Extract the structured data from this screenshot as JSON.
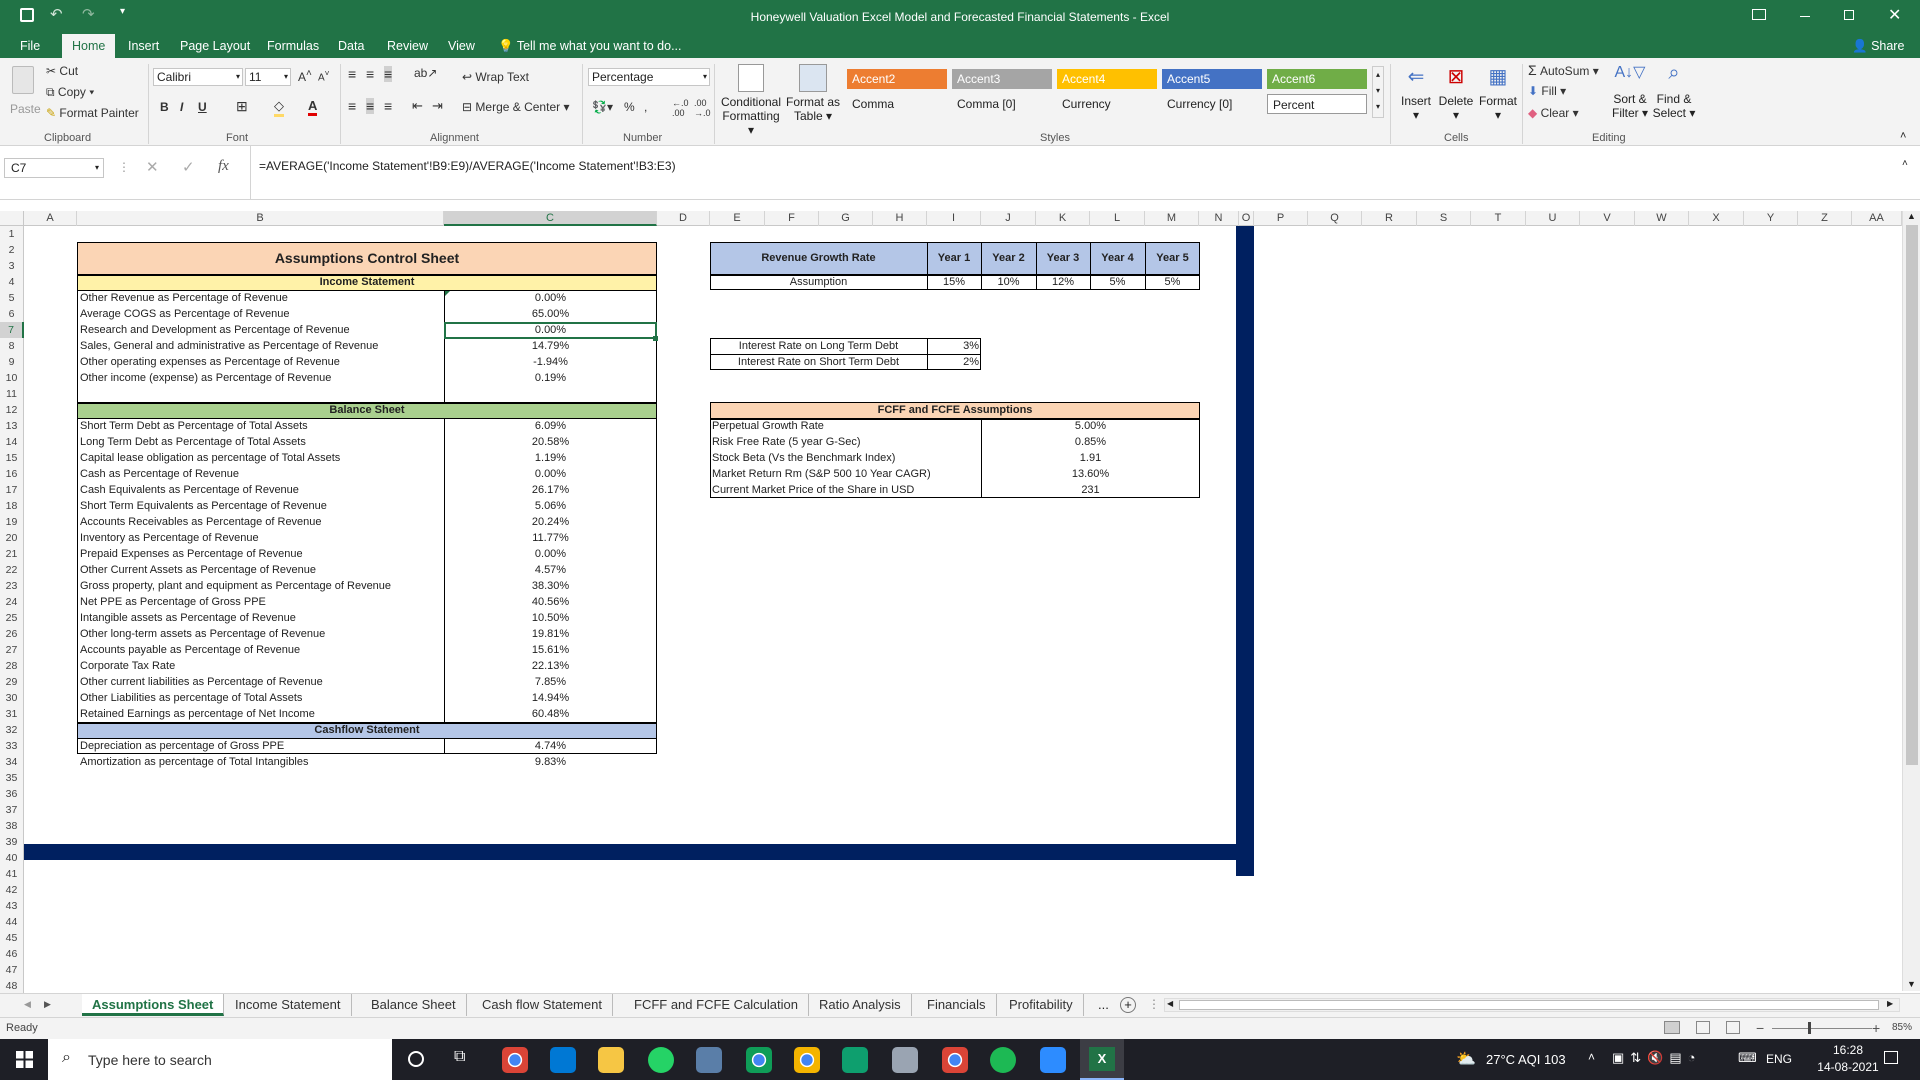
{
  "titlebar": {
    "title": "Honeywell Valuation Excel Model and Forecasted Financial Statements - Excel"
  },
  "ribbon_tabs": [
    "File",
    "Home",
    "Insert",
    "Page Layout",
    "Formulas",
    "Data",
    "Review",
    "View"
  ],
  "tell_me": "Tell me what you want to do...",
  "share": "Share",
  "clipboard": {
    "paste": "Paste",
    "cut": "Cut",
    "copy": "Copy",
    "painter": "Format Painter",
    "label": "Clipboard"
  },
  "font": {
    "name": "Calibri",
    "size": "11",
    "label": "Font"
  },
  "alignment": {
    "wrap": "Wrap Text",
    "merge": "Merge & Center",
    "label": "Alignment"
  },
  "number": {
    "format": "Percentage",
    "label": "Number"
  },
  "styles_group": {
    "cond": "Conditional",
    "cond2": "Formatting",
    "fmt_table": "Format as",
    "fmt_table2": "Table",
    "label": "Styles",
    "cells": [
      {
        "name": "Accent2",
        "bg": "#ed7d31",
        "fg": "#ffffff"
      },
      {
        "name": "Accent3",
        "bg": "#a5a5a5",
        "fg": "#ffffff"
      },
      {
        "name": "Accent4",
        "bg": "#ffc000",
        "fg": "#ffffff"
      },
      {
        "name": "Accent5",
        "bg": "#4472c4",
        "fg": "#ffffff"
      },
      {
        "name": "Accent6",
        "bg": "#70ad47",
        "fg": "#ffffff"
      },
      {
        "name": "Comma",
        "bg": "#ffffff",
        "fg": "#222222"
      },
      {
        "name": "Comma [0]",
        "bg": "#ffffff",
        "fg": "#222222"
      },
      {
        "name": "Currency",
        "bg": "#ffffff",
        "fg": "#222222"
      },
      {
        "name": "Currency [0]",
        "bg": "#ffffff",
        "fg": "#222222"
      },
      {
        "name": "Percent",
        "bg": "#ffffff",
        "fg": "#222222"
      }
    ]
  },
  "cells_group": {
    "insert": "Insert",
    "delete": "Delete",
    "format": "Format",
    "label": "Cells"
  },
  "editing": {
    "autosum": "AutoSum",
    "fill": "Fill",
    "clear": "Clear",
    "sort": "Sort &",
    "sort2": "Filter",
    "find": "Find &",
    "find2": "Select",
    "label": "Editing"
  },
  "namebox": "C7",
  "formula": "=AVERAGE('Income Statement'!B9:E9)/AVERAGE('Income Statement'!B3:E3)",
  "columns": [
    "A",
    "B",
    "C",
    "D",
    "E",
    "F",
    "G",
    "H",
    "I",
    "J",
    "K",
    "L",
    "M",
    "N",
    "O",
    "P",
    "Q",
    "R",
    "S",
    "T",
    "U",
    "V",
    "W",
    "X",
    "Y",
    "Z",
    "AA"
  ],
  "control_sheet": {
    "title": "Assumptions Control Sheet",
    "income_header": "Income Statement",
    "income_rows": [
      {
        "label": "Other Revenue as Percentage of Revenue",
        "value": "0.00%"
      },
      {
        "label": "Average COGS as Percentage of Revenue",
        "value": "65.00%"
      },
      {
        "label": "Research and Development as Percentage of Revenue",
        "value": "0.00%"
      },
      {
        "label": "Sales, General and administrative as Percentage of Revenue",
        "value": "14.79%"
      },
      {
        "label": "Other operating expenses as Percentage of Revenue",
        "value": "-1.94%"
      },
      {
        "label": "Other income (expense) as Percentage of Revenue",
        "value": "0.19%"
      }
    ],
    "balance_header": "Balance Sheet",
    "balance_rows": [
      {
        "label": "Short Term Debt as Percentage of Total Assets",
        "value": "6.09%"
      },
      {
        "label": "Long Term Debt as Percentage of Total Assets",
        "value": "20.58%"
      },
      {
        "label": "Capital lease obligation as percentage of Total Assets",
        "value": "1.19%"
      },
      {
        "label": "Cash as Percentage of Revenue",
        "value": "0.00%"
      },
      {
        "label": "Cash Equivalents as Percentage of Revenue",
        "value": "26.17%"
      },
      {
        "label": "Short Term Equivalents as Percentage of Revenue",
        "value": "5.06%"
      },
      {
        "label": "Accounts Receivables as Percentage of Revenue",
        "value": "20.24%"
      },
      {
        "label": "Inventory as Percentage of Revenue",
        "value": "11.77%"
      },
      {
        "label": "Prepaid Expenses as Percentage of Revenue",
        "value": "0.00%"
      },
      {
        "label": "Other Current Assets as Percentage of Revenue",
        "value": "4.57%"
      },
      {
        "label": "Gross property, plant and equipment as Percentage of Revenue",
        "value": "38.30%"
      },
      {
        "label": "Net PPE as Percentage of Gross PPE",
        "value": "40.56%"
      },
      {
        "label": "Intangible assets as Percentage of Revenue",
        "value": "10.50%"
      },
      {
        "label": "Other long-term assets as Percentage of Revenue",
        "value": "19.81%"
      },
      {
        "label": "Accounts payable as Percentage of Revenue",
        "value": "15.61%"
      },
      {
        "label": "Corporate Tax Rate",
        "value": "22.13%"
      },
      {
        "label": "Other current liabilities as Percentage of Revenue",
        "value": "7.85%"
      },
      {
        "label": "Other Liabilities as percentage of Total Assets",
        "value": "14.94%"
      },
      {
        "label": "Retained Earnings as percentage of Net Income",
        "value": "60.48%"
      }
    ],
    "cashflow_header": "Cashflow Statement",
    "cashflow_rows": [
      {
        "label": "Depreciation as percentage of Gross PPE",
        "value": "4.74%"
      },
      {
        "label": "Amortization as percentage of Total Intangibles",
        "value": "9.83%"
      }
    ]
  },
  "growth": {
    "header": "Revenue Growth Rate",
    "years": [
      "Year 1",
      "Year 2",
      "Year 3",
      "Year 4",
      "Year 5"
    ],
    "row_label": "Assumption",
    "values": [
      "15%",
      "10%",
      "12%",
      "5%",
      "5%"
    ]
  },
  "interest": [
    {
      "label": "Interest Rate on Long Term Debt",
      "value": "3%"
    },
    {
      "label": "Interest Rate on Short Term Debt",
      "value": "2%"
    }
  ],
  "fcff": {
    "header": "FCFF and FCFE Assumptions",
    "rows": [
      {
        "label": "Perpetual Growth Rate",
        "value": "5.00%"
      },
      {
        "label": "Risk Free Rate (5 year G-Sec)",
        "value": "0.85%"
      },
      {
        "label": "Stock Beta (Vs the Benchmark Index)",
        "value": "1.91"
      },
      {
        "label": "Market Return Rm (S&P 500 10 Year CAGR)",
        "value": "13.60%"
      },
      {
        "label": "Current Market Price of the Share in USD",
        "value": "231"
      }
    ]
  },
  "sheet_tabs": [
    "Assumptions Sheet",
    "Income Statement",
    "Balance Sheet",
    "Cash flow Statement",
    "FCFF and FCFE Calculation",
    "Ratio Analysis",
    "Financials",
    "Profitability"
  ],
  "more_tabs": "...",
  "status": {
    "ready": "Ready",
    "zoom": "85%"
  },
  "taskbar": {
    "search": "Type here to search",
    "weather": "27°C  AQI 103",
    "lang": "ENG",
    "time": "16:28",
    "date": "14-08-2021"
  },
  "colors": {
    "excel_green": "#217346",
    "orange_header": "#fbd5b5",
    "yellow_header": "#fff2a8",
    "green_header": "#a9d08e",
    "blue_header": "#b4c6e7",
    "navy": "#002060"
  }
}
